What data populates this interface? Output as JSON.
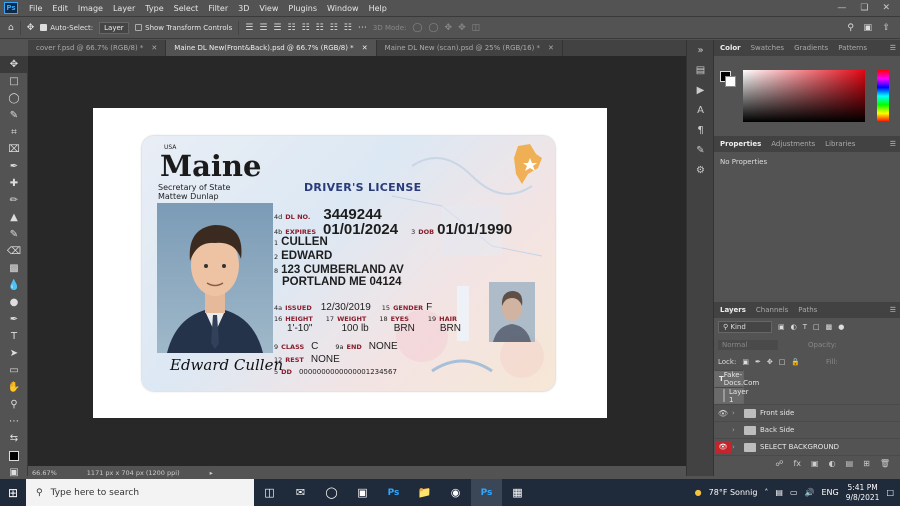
{
  "menubar": {
    "logo": "Ps",
    "items": [
      "File",
      "Edit",
      "Image",
      "Layer",
      "Type",
      "Select",
      "Filter",
      "3D",
      "View",
      "Plugins",
      "Window",
      "Help"
    ]
  },
  "optbar": {
    "auto_select": "Auto-Select:",
    "auto_select_value": "Layer",
    "show_transform": "Show Transform Controls",
    "mode_3d": "3D Mode:"
  },
  "tabs": [
    {
      "label": "cover f.psd @ 66.7% (RGB/8) *"
    },
    {
      "label": "Maine DL New(Front&Back).psd @ 66.7% (RGB/8) *"
    },
    {
      "label": "Maine DL New (scan).psd @ 25% (RGB/16) *"
    }
  ],
  "card": {
    "usa": "USA",
    "state": "Maine",
    "secretary": "Secretary of State",
    "secretary_name": "Mattew Dunlap",
    "doc_type": "DRIVER'S LICENSE",
    "dl_no_label": "DL NO.",
    "dl_no": "3449244",
    "dl_no_field": "4d",
    "expires_label": "EXPIRES",
    "expires": "01/01/2024",
    "expires_field": "4b",
    "dob_label": "DOB",
    "dob": "01/01/1990",
    "dob_field": "3",
    "last": "CULLEN",
    "last_field": "1",
    "first": "EDWARD",
    "first_field": "2",
    "addr1": "123 CUMBERLAND AV",
    "addr2": "PORTLAND ME 04124",
    "addr_field": "8",
    "issued_label": "ISSUED",
    "issued": "12/30/2019",
    "issued_field": "4a",
    "sex_label": "GENDER",
    "sex": "F",
    "sex_field": "15",
    "height_label": "HEIGHT",
    "height": "1'-10\"",
    "height_field": "16",
    "weight_label": "WEIGHT",
    "weight": "100 lb",
    "weight_field": "17",
    "eyes_label": "EYES",
    "eyes": "BRN",
    "eyes_field": "18",
    "hair_label": "HAIR",
    "hair": "BRN",
    "hair_field": "19",
    "class_label": "CLASS",
    "class": "C",
    "class_field": "9",
    "end_label": "END",
    "end": "NONE",
    "end_field": "9a",
    "rest_label": "REST",
    "rest": "NONE",
    "rest_field": "12",
    "dd_label": "DD",
    "dd": "0000000000000001234567",
    "dd_field": "5",
    "signature": "Edward Cullen"
  },
  "panels": {
    "color_tabs": [
      "Color",
      "Swatches",
      "Gradients",
      "Patterns"
    ],
    "prop_tabs": [
      "Properties",
      "Adjustments",
      "Libraries"
    ],
    "no_properties": "No Properties",
    "layer_tabs": [
      "Layers",
      "Channels",
      "Paths"
    ],
    "kind": "Kind",
    "blend": "Normal",
    "opacity_label": "Opacity:",
    "lock_label": "Lock:",
    "fill_label": "Fill:",
    "layers": [
      {
        "name": "Fake-Docs.Com",
        "type": "text"
      },
      {
        "name": "Layer 1",
        "type": "image"
      },
      {
        "name": "Front side",
        "type": "folder"
      },
      {
        "name": "Back Side",
        "type": "folder"
      },
      {
        "name": "SELECT BACKGROUND",
        "type": "folder"
      }
    ]
  },
  "status": {
    "zoom": "66.67%",
    "size": "1171 px x 704 px (1200 ppi)"
  },
  "taskbar": {
    "search_placeholder": "Type here to search",
    "weather": "78°F  Sonnig",
    "lang": "ENG",
    "time": "5:41 PM",
    "date": "9/8/2021"
  }
}
